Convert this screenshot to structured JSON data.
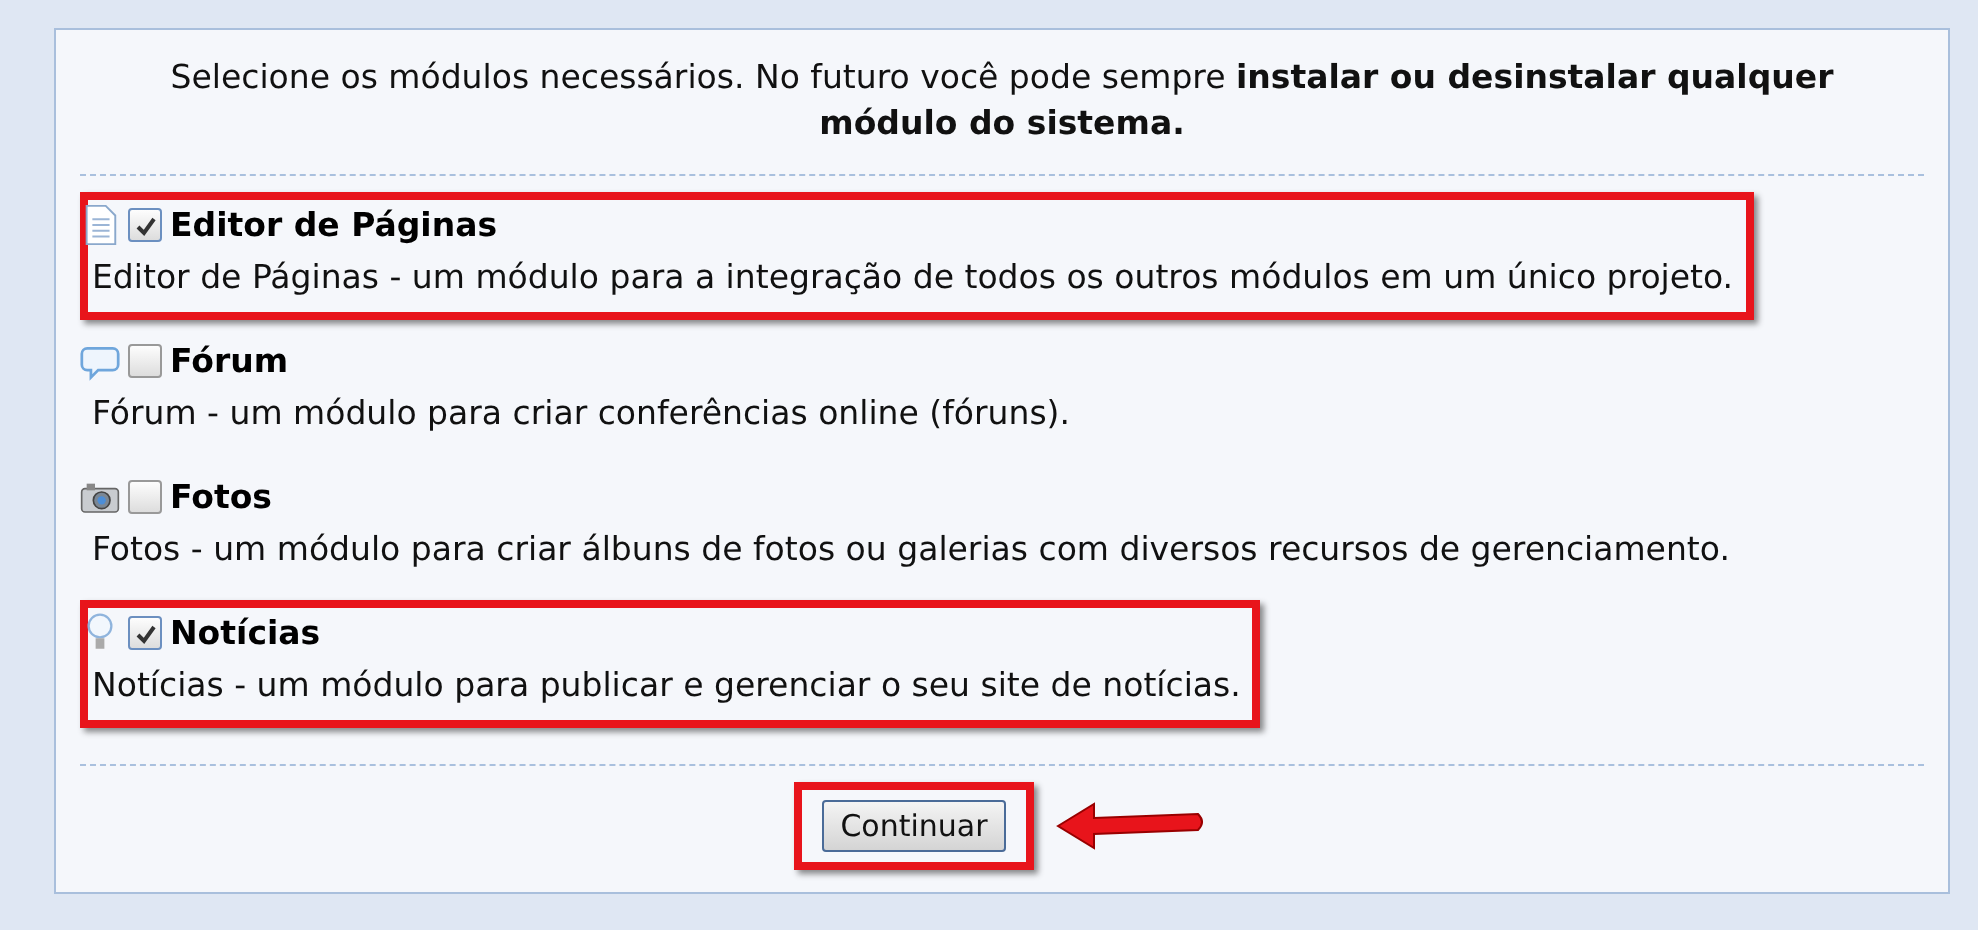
{
  "intro": "Selecione os módulos necessários. No futuro você pode sempre **instalar ou desinstalar qualquer módulo do sistema.**",
  "modules": [
    {
      "title": "Editor de Páginas",
      "description": "Editor de Páginas - um módulo para a integração de todos os outros módulos em um único projeto.",
      "checked": true,
      "highlighted": true
    },
    {
      "title": "Fórum",
      "description": "Fórum - um módulo para criar conferências online (fóruns).",
      "checked": false,
      "highlighted": false
    },
    {
      "title": "Fotos",
      "description": "Fotos - um módulo para criar álbuns de fotos ou galerias com diversos recursos de gerenciamento.",
      "checked": false,
      "highlighted": false
    },
    {
      "title": "Notícias",
      "description": "Notícias - um módulo para publicar e gerenciar o seu site de notícias.",
      "checked": true,
      "highlighted": true
    }
  ],
  "button": {
    "label": "Continuar",
    "highlighted": true,
    "arrow": true
  }
}
